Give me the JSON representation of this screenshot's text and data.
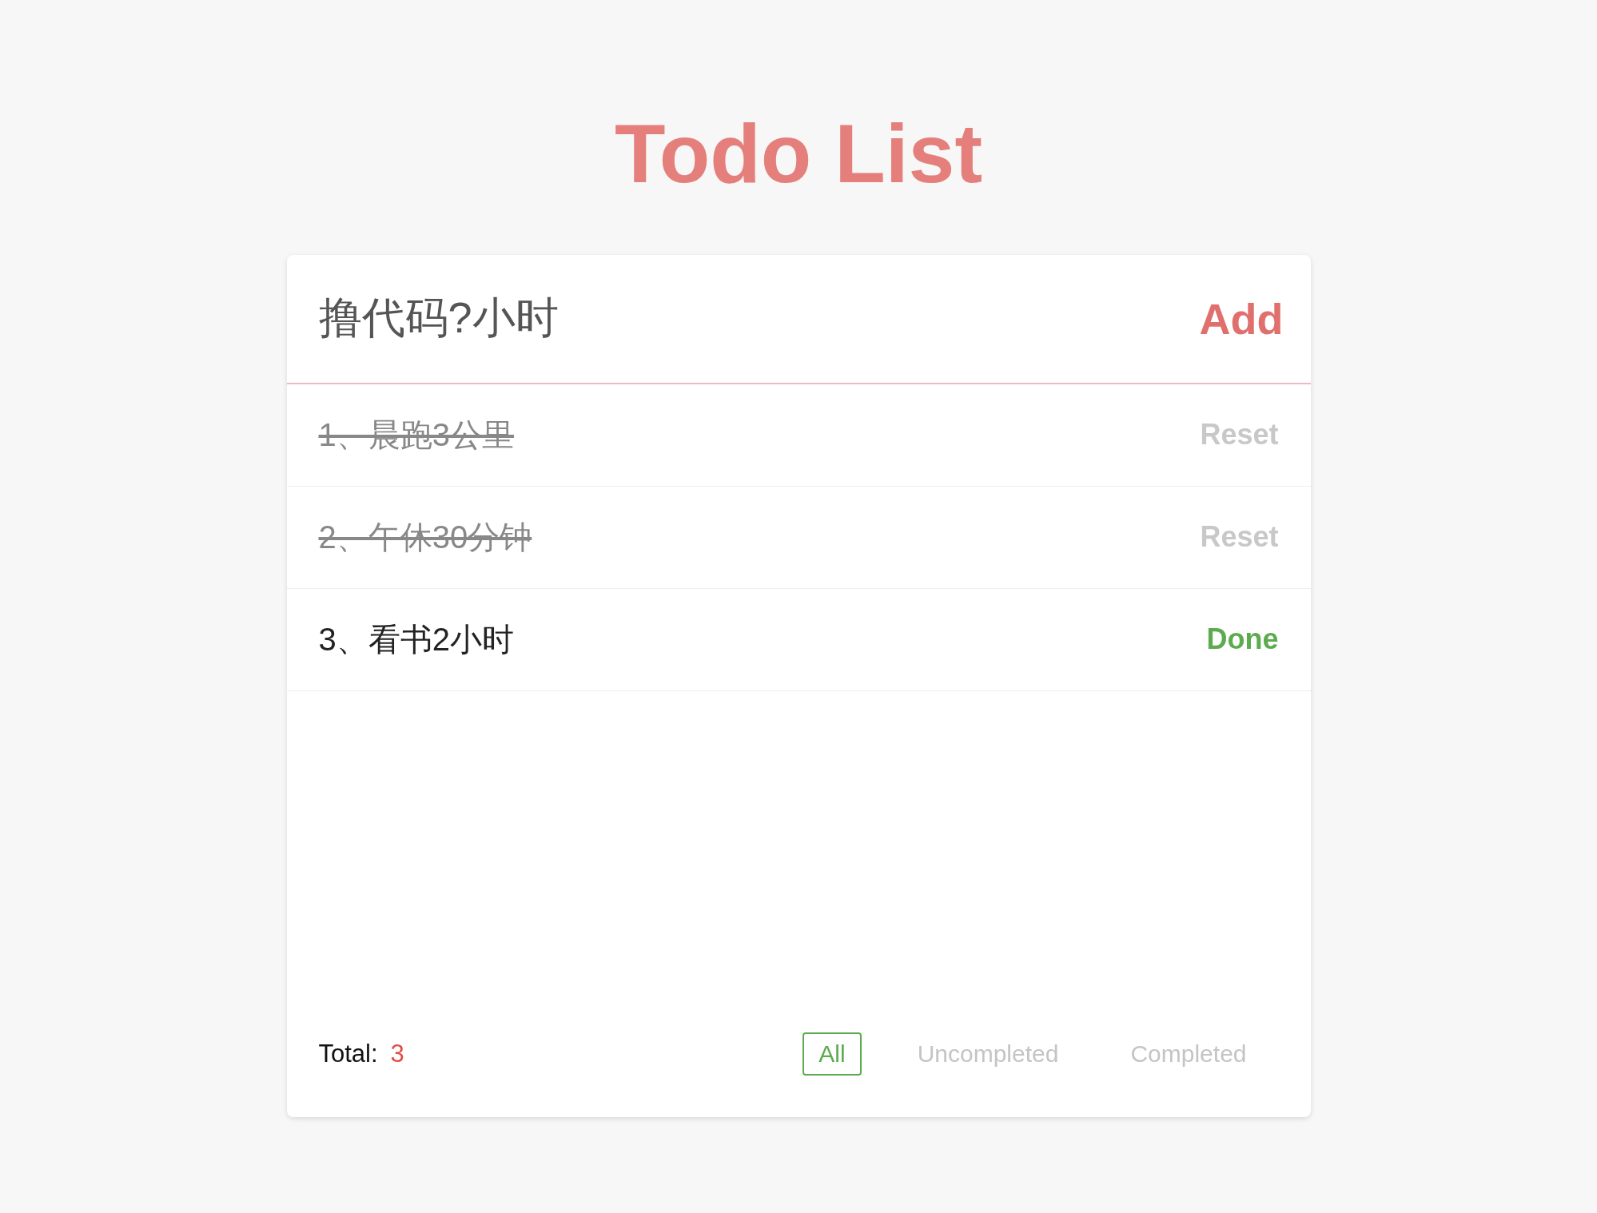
{
  "title": "Todo List",
  "input": {
    "value": "撸代码?小时"
  },
  "add_button": "Add",
  "todos": [
    {
      "text": "1、晨跑3公里",
      "done": true,
      "action": "Reset"
    },
    {
      "text": "2、午休30分钟",
      "done": true,
      "action": "Reset"
    },
    {
      "text": "3、看书2小时",
      "done": false,
      "action": "Done"
    }
  ],
  "footer": {
    "total_label": "Total:",
    "total": "3",
    "filters": [
      {
        "label": "All",
        "selected": true
      },
      {
        "label": "Uncompleted",
        "selected": false
      },
      {
        "label": "Completed",
        "selected": false
      }
    ]
  }
}
